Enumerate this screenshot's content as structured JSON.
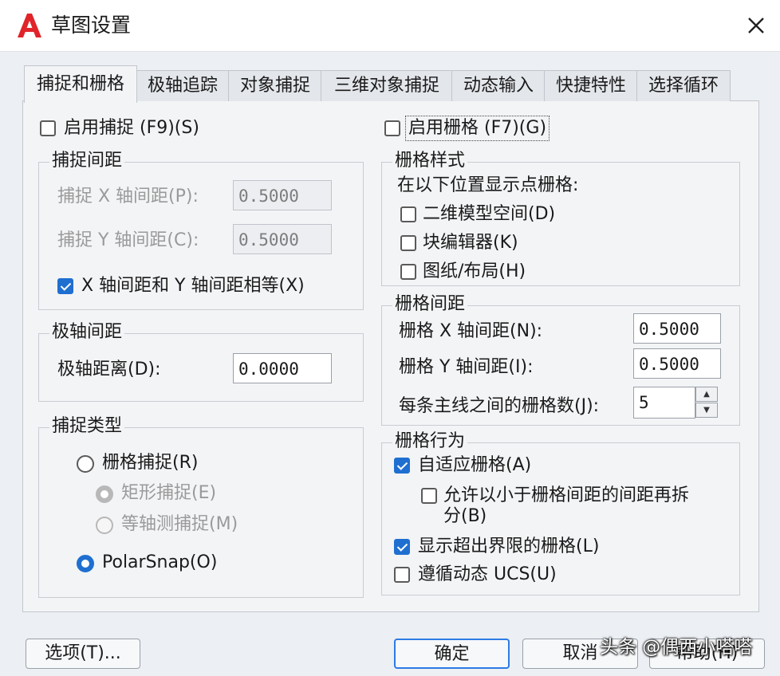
{
  "window": {
    "title": "草图设置"
  },
  "tabs": [
    {
      "label": "捕捉和栅格",
      "active": true
    },
    {
      "label": "极轴追踪"
    },
    {
      "label": "对象捕捉"
    },
    {
      "label": "三维对象捕捉"
    },
    {
      "label": "动态输入"
    },
    {
      "label": "快捷特性"
    },
    {
      "label": "选择循环"
    }
  ],
  "snap": {
    "enable_label": "启用捕捉 (F9)(S)",
    "enabled": false,
    "spacing": {
      "title": "捕捉间距",
      "x_label": "捕捉 X 轴间距(P):",
      "x_value": "0.5000",
      "y_label": "捕捉 Y 轴间距(C):",
      "y_value": "0.5000",
      "equal_label": "X 轴间距和 Y 轴间距相等(X)",
      "equal_checked": true
    },
    "polar": {
      "title": "极轴间距",
      "distance_label": "极轴距离(D):",
      "distance_value": "0.0000"
    },
    "type": {
      "title": "捕捉类型",
      "grid_snap_label": "栅格捕捉(R)",
      "rect_label": "矩形捕捉(E)",
      "iso_label": "等轴测捕捉(M)",
      "polar_label": "PolarSnap(O)",
      "selected": "polar"
    }
  },
  "grid": {
    "enable_label": "启用栅格 (F7)(G)",
    "enabled": false,
    "style": {
      "title": "栅格样式",
      "subtitle": "在以下位置显示点栅格:",
      "model_label": "二维模型空间(D)",
      "block_label": "块编辑器(K)",
      "sheet_label": "图纸/布局(H)"
    },
    "spacing": {
      "title": "栅格间距",
      "x_label": "栅格 X 轴间距(N):",
      "x_value": "0.5000",
      "y_label": "栅格 Y 轴间距(I):",
      "y_value": "0.5000",
      "major_label": "每条主线之间的栅格数(J):",
      "major_value": "5"
    },
    "behavior": {
      "title": "栅格行为",
      "adaptive_label": "自适应栅格(A)",
      "adaptive_checked": true,
      "subdivide_label_1": "允许以小于栅格间距的间距再拆",
      "subdivide_label_2": "分(B)",
      "subdivide_checked": false,
      "beyond_label": "显示超出界限的栅格(L)",
      "beyond_checked": true,
      "follow_label": "遵循动态 UCS(U)",
      "follow_checked": false
    }
  },
  "buttons": {
    "options": "选项(T)...",
    "ok": "确定",
    "cancel": "取消",
    "help": "帮助(H)"
  },
  "watermark": "头条 @偶西小嗒嗒",
  "colors": {
    "accent": "#1f6fd0",
    "logo": "#e0242a"
  },
  "icons": {
    "app": "autocad-logo-icon",
    "close": "close-icon"
  }
}
